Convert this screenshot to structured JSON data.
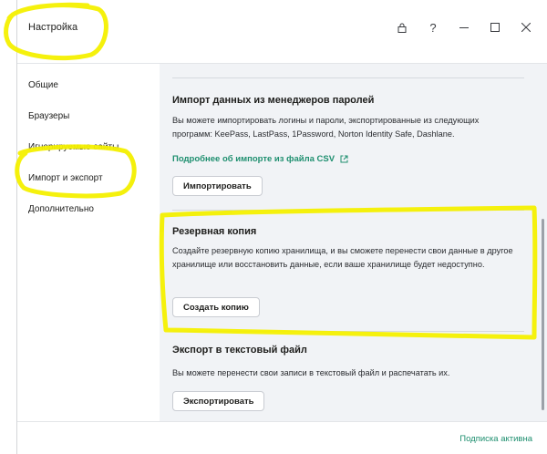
{
  "window": {
    "title": "Настройка",
    "controls": {
      "lock": "lock-icon",
      "help": "?",
      "minimize": "minimize-icon",
      "maximize": "maximize-icon",
      "close": "close-icon"
    }
  },
  "sidebar": {
    "items": [
      {
        "label": "Общие"
      },
      {
        "label": "Браузеры"
      },
      {
        "label": "Игнорируемые сайты"
      },
      {
        "label": "Импорт и экспорт"
      },
      {
        "label": "Дополнительно"
      }
    ]
  },
  "sections": {
    "import": {
      "title": "Импорт данных из менеджеров паролей",
      "text": "Вы можете импортировать логины и пароли, экспортированные из следующих программ: KeePass, LastPass, 1Password, Norton Identity Safe, Dashlane.",
      "link": "Подробнее об импорте из файла CSV",
      "button": "Импортировать"
    },
    "backup": {
      "title": "Резервная копия",
      "text": "Создайте резервную копию хранилища, и вы сможете перенести свои данные в другое хранилище или восстановить данные, если ваше хранилище будет недоступно.",
      "button": "Создать копию"
    },
    "export": {
      "title": "Экспорт в текстовый файл",
      "text": "Вы можете перенести свои записи в текстовый файл и распечатать их.",
      "button": "Экспортировать"
    }
  },
  "footer": {
    "status": "Подписка активна"
  },
  "colors": {
    "accent": "#1e8f6f",
    "marker": "#f4f000",
    "content_bg": "#f1f3f6"
  }
}
